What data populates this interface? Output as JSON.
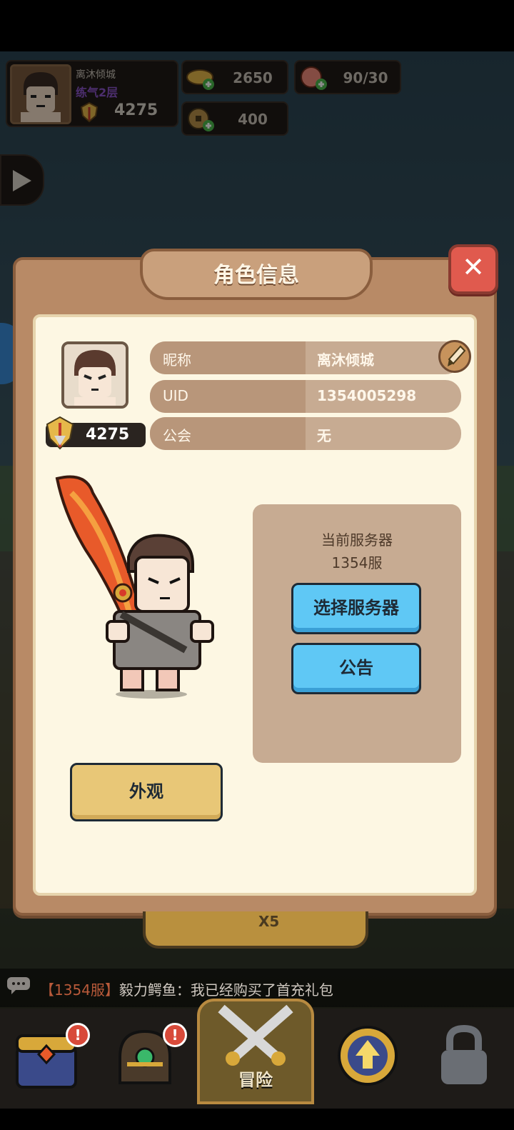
{
  "hud": {
    "player_name": "离沐倾城",
    "level": "练气2层",
    "power": "4275",
    "gold": "2650",
    "stamina": "90/30",
    "coins": "400"
  },
  "dialog": {
    "title": "角色信息",
    "power": "4275",
    "rows": [
      {
        "label": "昵称",
        "value": "离沐倾城"
      },
      {
        "label": "UID",
        "value": "1354005298"
      },
      {
        "label": "公会",
        "value": "无"
      }
    ],
    "server_title": "当前服务器",
    "server_name": "1354服",
    "select_server_button": "选择服务器",
    "announcement_button": "公告",
    "appearance_button": "外观"
  },
  "background": {
    "peek_reward": "X5"
  },
  "chat": {
    "tag": "【1354服】",
    "message": "毅力鳄鱼：我已经购买了首充礼包"
  },
  "nav": {
    "active_label": "冒险",
    "badge_1": "!",
    "badge_2": "!"
  },
  "colors": {
    "dialog_frame": "#b88a66",
    "panel": "#fdf7e3",
    "blue_button": "#5fc8f5",
    "yellow_button": "#e8c777",
    "close_red": "#e05a4e"
  },
  "icons": [
    "gold-ingot-icon",
    "peach-icon",
    "coin-icon",
    "power-helmet-icon",
    "brush-edit-icon",
    "close-icon",
    "play-icon",
    "chat-icon",
    "crossed-swords-icon",
    "upgrade-arrow-icon"
  ]
}
